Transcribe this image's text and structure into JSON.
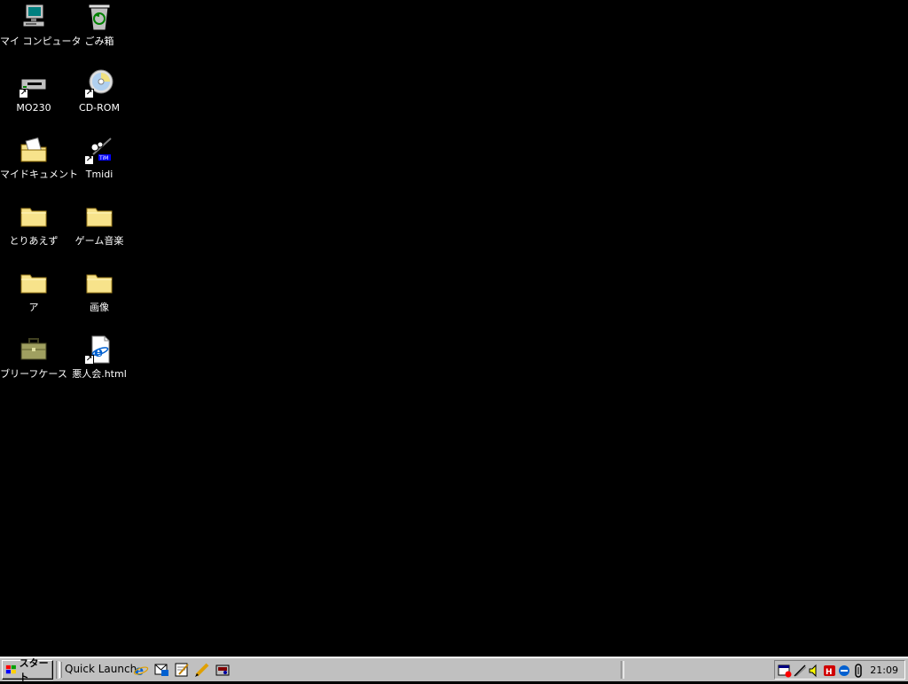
{
  "desktop": {
    "background_color": "#000000",
    "icons": [
      {
        "label": "マイ コンピュータ",
        "icon": "my-computer-icon"
      },
      {
        "label": "ごみ箱",
        "icon": "recycle-bin-icon"
      },
      {
        "label": "MO230",
        "icon": "mo-drive-icon"
      },
      {
        "label": "CD-ROM",
        "icon": "cd-rom-icon"
      },
      {
        "label": "マイドキュメント",
        "icon": "my-documents-icon"
      },
      {
        "label": "Tmidi",
        "icon": "tmidi-icon"
      },
      {
        "label": "とりあえず",
        "icon": "folder-icon"
      },
      {
        "label": "ゲーム音楽",
        "icon": "folder-icon"
      },
      {
        "label": "ア",
        "icon": "folder-icon"
      },
      {
        "label": "画像",
        "icon": "folder-icon"
      },
      {
        "label": "ブリーフケース",
        "icon": "briefcase-icon"
      },
      {
        "label": "悪人会.html",
        "icon": "html-document-icon"
      }
    ]
  },
  "taskbar": {
    "start_label": "スタート",
    "quick_launch_label": "Quick Launch",
    "quick_launch_icons": [
      "internet-explorer-icon",
      "outlook-express-icon",
      "notepad-icon",
      "pencil-icon",
      "app-icon"
    ],
    "tray_icons": [
      "scheduler-icon",
      "pen-icon",
      "volume-icon",
      "ime-icon",
      "ie-tray-icon",
      "clip-icon"
    ],
    "clock": "21:09"
  },
  "colors": {
    "taskbar": "#c0c0c0",
    "folder": "#f7e38b",
    "label_text": "#ffffff"
  }
}
